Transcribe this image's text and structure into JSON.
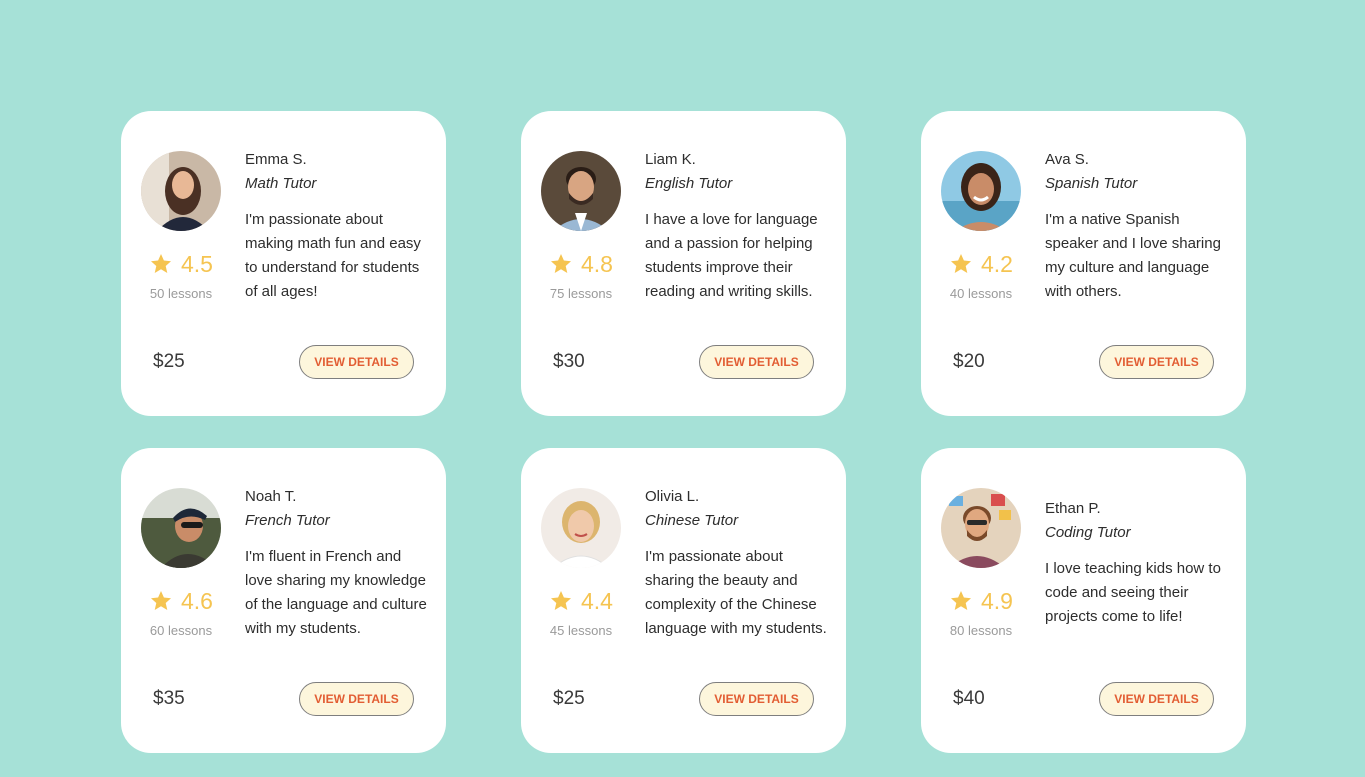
{
  "tutors": [
    {
      "name": "Emma S.",
      "subject": "Math Tutor",
      "bio": "I'm passionate about making math fun and easy to understand for students of all ages!",
      "rating": "4.5",
      "lessons": "50 lessons",
      "price": "$25",
      "button_label": "View details"
    },
    {
      "name": "Liam K.",
      "subject": "English Tutor",
      "bio": "I have a love for language and a passion for helping students improve their reading and writing skills.",
      "rating": "4.8",
      "lessons": "75 lessons",
      "price": "$30",
      "button_label": "View details"
    },
    {
      "name": "Ava S.",
      "subject": "Spanish Tutor",
      "bio": "I'm a native Spanish speaker and I love sharing my culture and language with others.",
      "rating": "4.2",
      "lessons": "40 lessons",
      "price": "$20",
      "button_label": "View details"
    },
    {
      "name": "Noah T.",
      "subject": "French Tutor",
      "bio": "I'm fluent in French and love sharing my knowledge of the language and culture with my students.",
      "rating": "4.6",
      "lessons": "60 lessons",
      "price": "$35",
      "button_label": "View details"
    },
    {
      "name": "Olivia L.",
      "subject": "Chinese Tutor",
      "bio": "I'm passionate about sharing the beauty and complexity of the Chinese language with my students.",
      "rating": "4.4",
      "lessons": "45 lessons",
      "price": "$25",
      "button_label": "View details"
    },
    {
      "name": "Ethan P.",
      "subject": "Coding Tutor",
      "bio": "I love teaching kids how to code and seeing their projects come to life!",
      "rating": "4.9",
      "lessons": "80 lessons",
      "price": "$40",
      "button_label": "View details"
    }
  ],
  "colors": {
    "background": "#a6e1d7",
    "card": "#ffffff",
    "star": "#f5c451",
    "button_bg": "#fdf6dc",
    "button_text": "#e25d33"
  },
  "icons": {
    "rating": "star-icon",
    "avatar": "tutor-photo"
  }
}
